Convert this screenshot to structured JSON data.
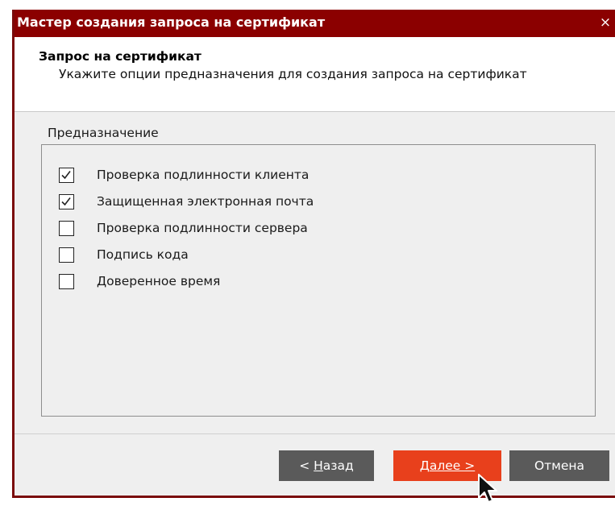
{
  "window": {
    "title": "Мастер создания запроса на сертификат",
    "close_glyph": "×"
  },
  "header": {
    "title": "Запрос на сертификат",
    "subtitle": "Укажите опции предназначения для создания запроса на сертификат"
  },
  "purpose": {
    "group_label": "Предназначение",
    "items": [
      {
        "label": "Проверка подлинности клиента",
        "checked": true
      },
      {
        "label": "Защищенная электронная почта",
        "checked": true
      },
      {
        "label": "Проверка подлинности сервера",
        "checked": false
      },
      {
        "label": "Подпись кода",
        "checked": false
      },
      {
        "label": "Доверенное время",
        "checked": false
      }
    ]
  },
  "buttons": {
    "back": {
      "prefix": "< ",
      "mnemonic": "Н",
      "rest": "азад"
    },
    "next": {
      "prefix": "",
      "mnemonic": "Д",
      "rest": "алее >"
    },
    "cancel": {
      "label": "Отмена"
    }
  },
  "colors": {
    "titlebar": "#8b0000",
    "accent_button": "#e8401c",
    "neutral_button": "#5a5a5a"
  },
  "icons": {
    "close": "close-icon",
    "check": "checkmark-icon",
    "cursor": "mouse-pointer-icon"
  }
}
